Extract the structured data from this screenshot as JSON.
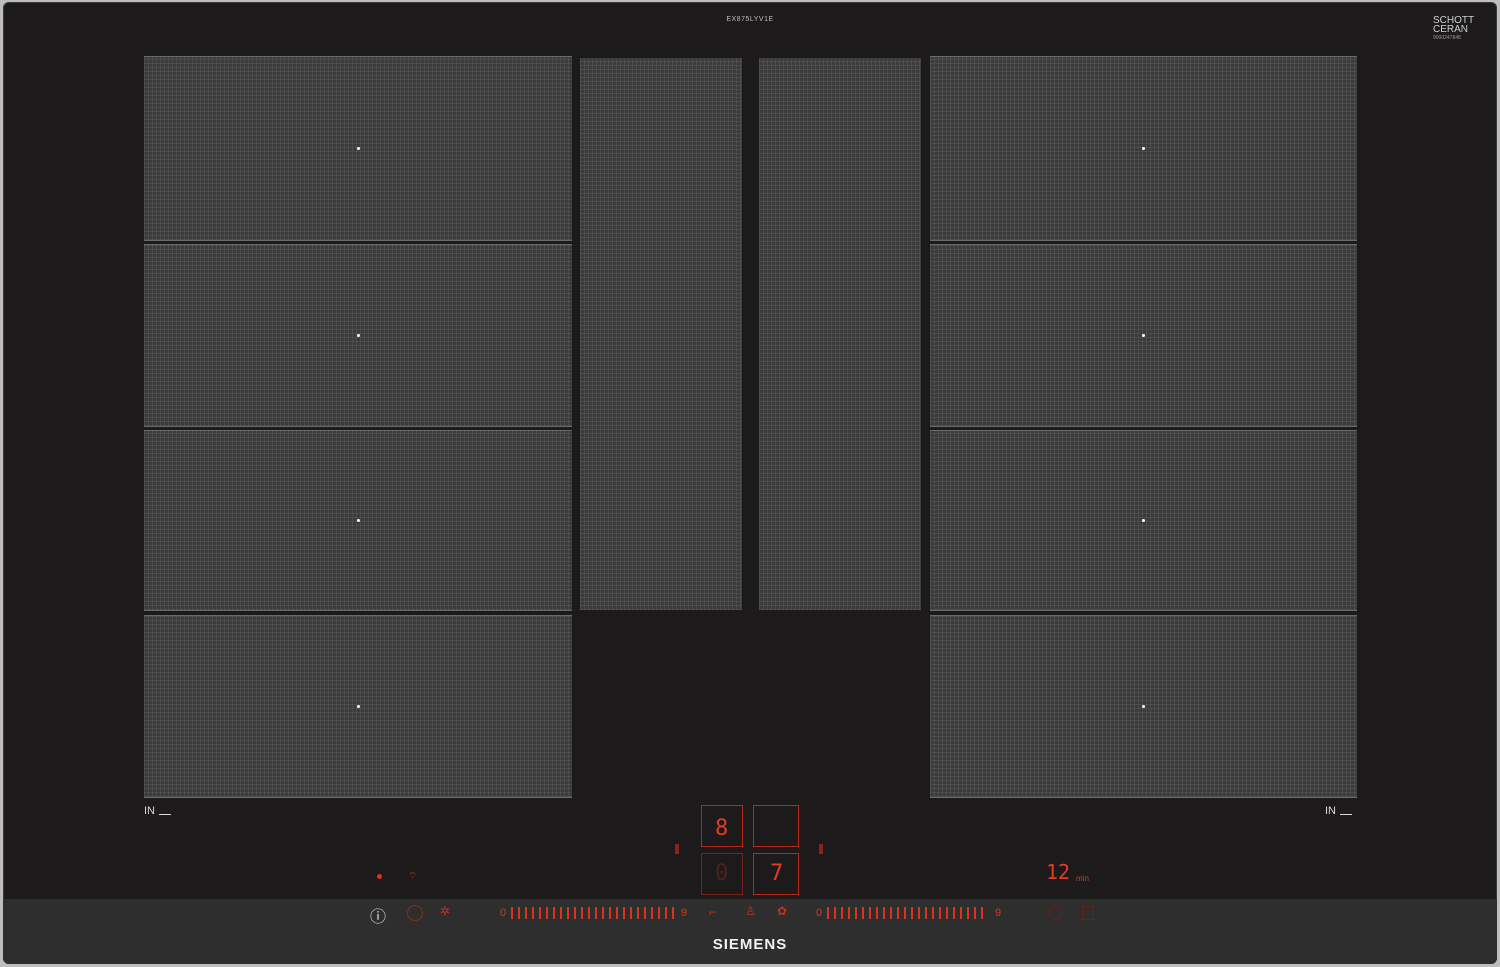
{
  "model_code": "EX875LYV1E",
  "glass_brand": [
    "SCHOTT",
    "CERAN",
    "9000247848"
  ],
  "brand": "SIEMENS",
  "zone_labels": {
    "left": "IN",
    "right": "IN"
  },
  "timer": {
    "value": "12",
    "unit": "min"
  },
  "displays": {
    "top_left_digit": "8",
    "bottom_right_digit": "7",
    "bottom_left_digit": "0"
  },
  "controls": {
    "info_icon": "ⓘ",
    "slider_left_start": "0",
    "slider_left_end": "9",
    "slider_right_start": "0",
    "slider_right_end": "9"
  },
  "colors": {
    "glass": "#1d1a1b",
    "zone": "#3c3c3c",
    "led_red": "#e0301e"
  }
}
